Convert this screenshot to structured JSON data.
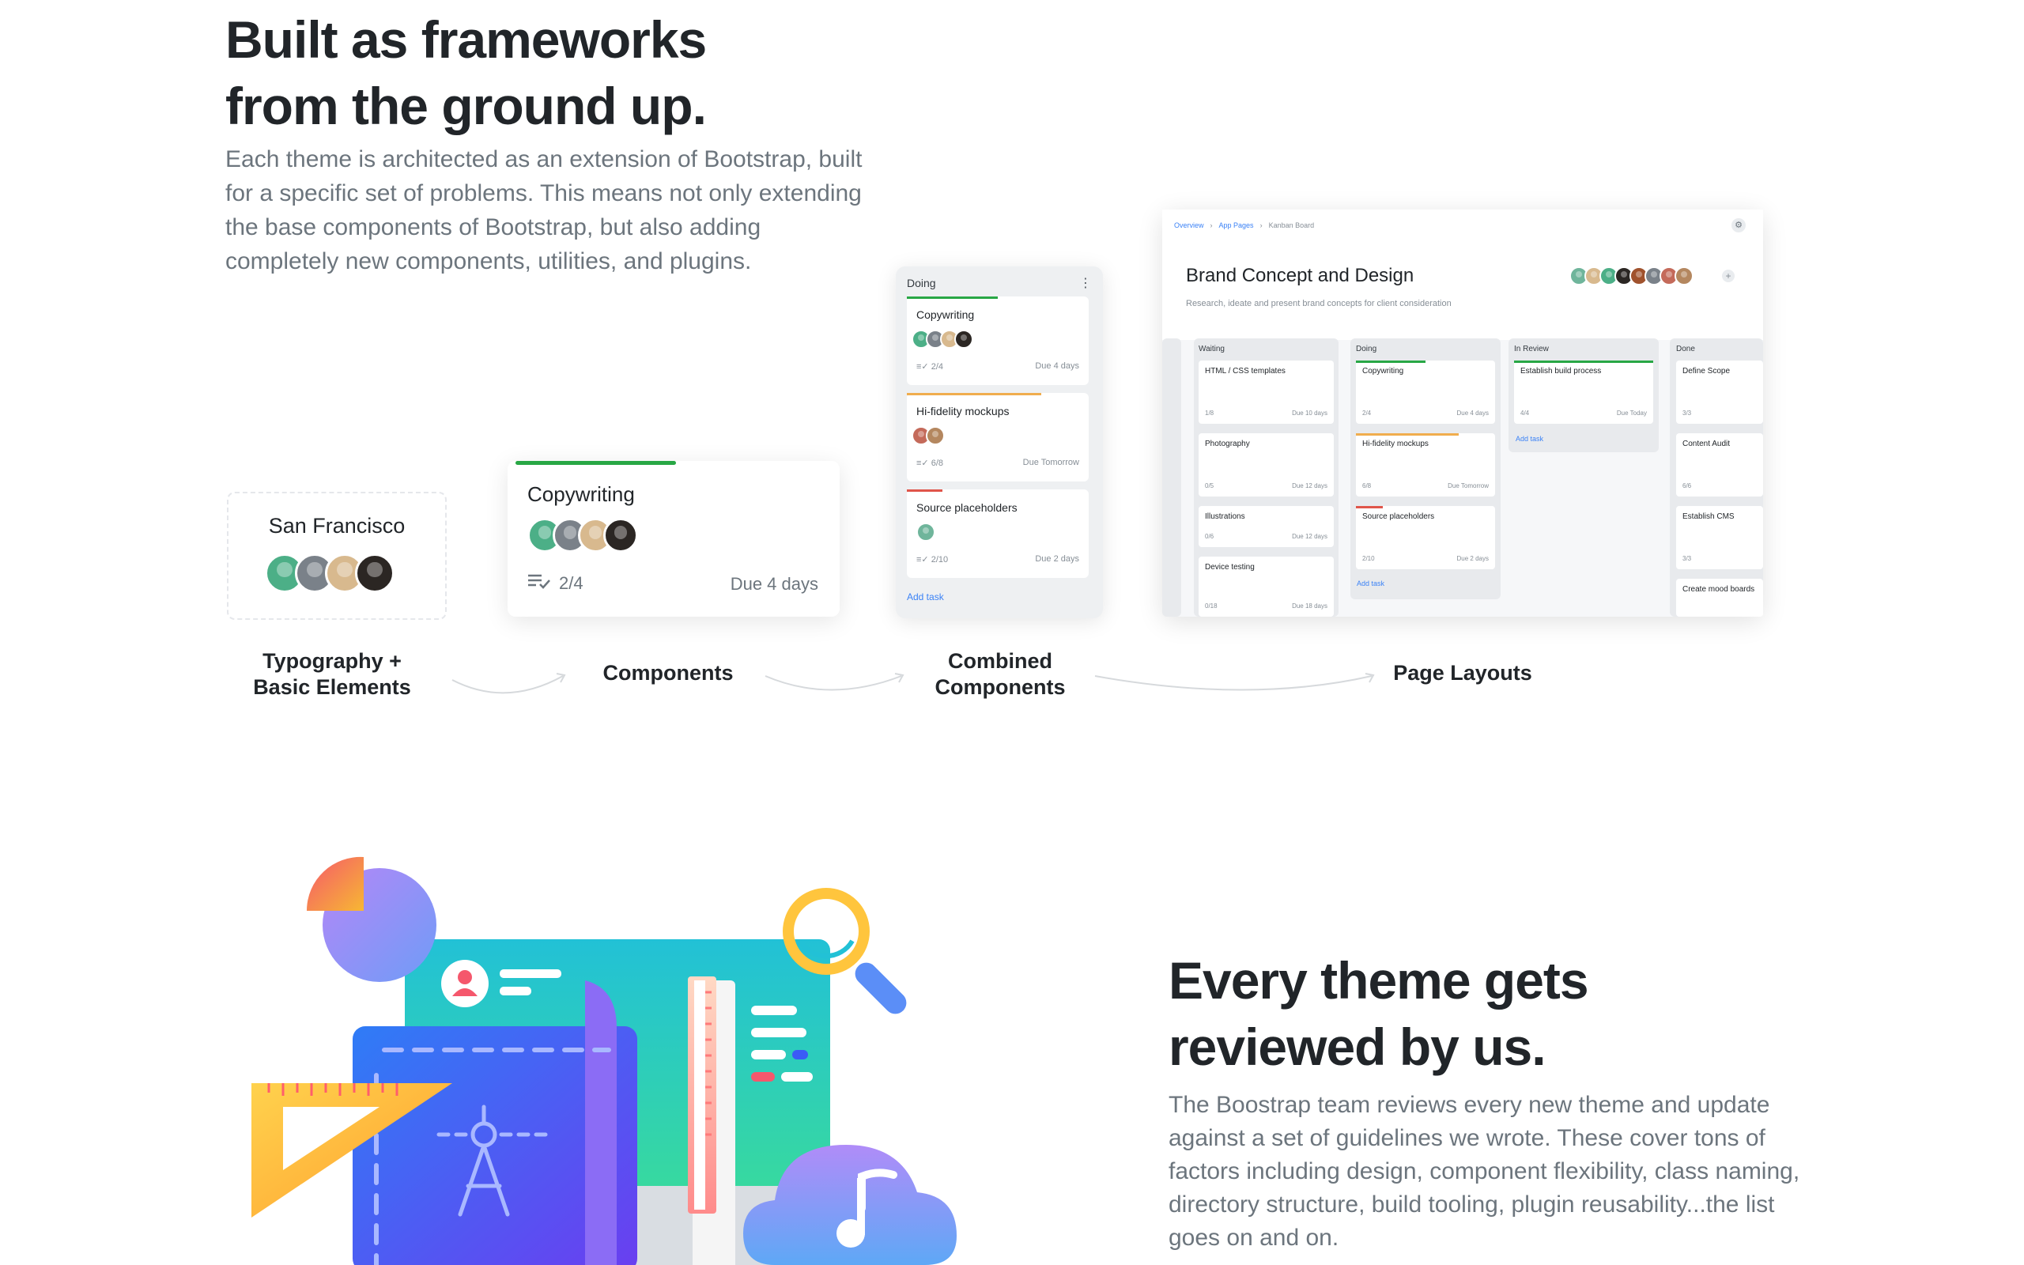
{
  "hero": {
    "title_line1": "Built as frameworks",
    "title_line2": "from the ground up.",
    "lead": "Each theme is architected as an extension of Bootstrap, built for a specific set of problems. This means not only extending the base components of Bootstrap, but also adding completely new components, utilities, and plugins."
  },
  "stages": {
    "typography": {
      "label_line1": "Typography +",
      "label_line2": "Basic Elements",
      "city": "San Francisco"
    },
    "components": {
      "label": "Components",
      "card_title": "Copywriting",
      "checklist": "2/4",
      "due": "Due 4 days"
    },
    "combined": {
      "label_line1": "Combined",
      "label_line2": "Components",
      "column_title": "Doing",
      "cards": [
        {
          "title": "Copywriting",
          "checklist": "2/4",
          "due": "Due 4 days",
          "bar_color": "#28a745"
        },
        {
          "title": "Hi-fidelity mockups",
          "checklist": "6/8",
          "due": "Due Tomorrow",
          "bar_color": "#f0ad4e"
        },
        {
          "title": "Source placeholders",
          "checklist": "2/10",
          "due": "Due 2 days",
          "bar_color": "#e0554a"
        }
      ],
      "add_task": "Add task"
    },
    "page_layouts": {
      "label": "Page Layouts",
      "breadcrumb": [
        "Overview",
        "App Pages",
        "Kanban Board"
      ],
      "title": "Brand Concept and Design",
      "subtitle": "Research, ideate and present brand concepts for client consideration",
      "add_task": "Add task",
      "columns": [
        {
          "title": "Waiting",
          "cards": [
            {
              "title": "HTML / CSS templates",
              "meta": "1/8",
              "due": "Due 10 days"
            },
            {
              "title": "Photography",
              "meta": "0/5",
              "due": "Due 12 days"
            },
            {
              "title": "Illustrations",
              "meta": "0/6",
              "due": "Due 12 days"
            },
            {
              "title": "Device testing",
              "meta": "0/18",
              "due": "Due 18 days"
            }
          ]
        },
        {
          "title": "Doing",
          "cards": [
            {
              "title": "Copywriting",
              "meta": "2/4",
              "due": "Due 4 days"
            },
            {
              "title": "Hi-fidelity mockups",
              "meta": "6/8",
              "due": "Due Tomorrow"
            },
            {
              "title": "Source placeholders",
              "meta": "2/10",
              "due": "Due 2 days"
            }
          ]
        },
        {
          "title": "In Review",
          "cards": [
            {
              "title": "Establish build process",
              "meta": "4/4",
              "due": "Due Today"
            }
          ]
        },
        {
          "title": "Done",
          "cards": [
            {
              "title": "Define Scope",
              "meta": "3/3",
              "due": ""
            },
            {
              "title": "Content Audit",
              "meta": "6/6",
              "due": ""
            },
            {
              "title": "Establish CMS",
              "meta": "3/3",
              "due": ""
            },
            {
              "title": "Create mood boards",
              "meta": "",
              "due": ""
            }
          ]
        }
      ]
    }
  },
  "review": {
    "title_line1": "Every theme gets",
    "title_line2": "reviewed by us.",
    "lead": "The Boostrap team reviews every new theme and update against a set of guidelines we wrote. These cover tons of factors including design, component flexibility, class naming, directory structure, build tooling, plugin reusability...the list goes on and on."
  },
  "colors": {
    "success": "#28a745",
    "warning": "#f0ad4e",
    "danger": "#e0554a",
    "link": "#3b82f6",
    "muted": "#6c757d"
  }
}
